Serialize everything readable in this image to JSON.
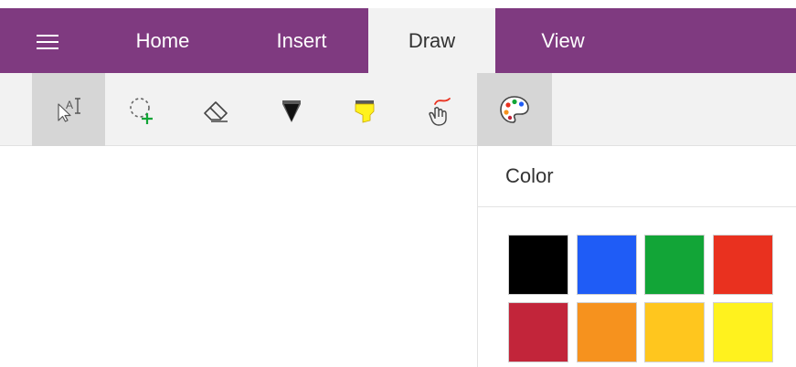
{
  "tabs": [
    {
      "label": "Home",
      "active": false
    },
    {
      "label": "Insert",
      "active": false
    },
    {
      "label": "Draw",
      "active": true
    },
    {
      "label": "View",
      "active": false
    }
  ],
  "toolbar": {
    "tools": [
      {
        "icon": "lasso-select-text-icon",
        "selected": true
      },
      {
        "icon": "add-space-icon",
        "selected": false
      },
      {
        "icon": "eraser-icon",
        "selected": false
      },
      {
        "icon": "black-pen-icon",
        "selected": false
      },
      {
        "icon": "yellow-highlighter-icon",
        "selected": false
      },
      {
        "icon": "ink-to-touch-icon",
        "selected": false
      },
      {
        "icon": "color-palette-icon",
        "selected": true
      }
    ]
  },
  "color_panel": {
    "title": "Color",
    "swatches": [
      {
        "name": "black",
        "color": "#000000"
      },
      {
        "name": "blue",
        "color": "#1f5cf6"
      },
      {
        "name": "green",
        "color": "#12a537"
      },
      {
        "name": "red",
        "color": "#e9311f"
      },
      {
        "name": "dark-red",
        "color": "#c2253a"
      },
      {
        "name": "orange",
        "color": "#f6921e"
      },
      {
        "name": "gold",
        "color": "#ffc61e"
      },
      {
        "name": "yellow",
        "color": "#fff21e"
      }
    ]
  },
  "colors": {
    "accent": "#7f3a80",
    "toolbar_bg": "#f2f2f2",
    "selected_tool_bg": "#d6d6d6"
  }
}
